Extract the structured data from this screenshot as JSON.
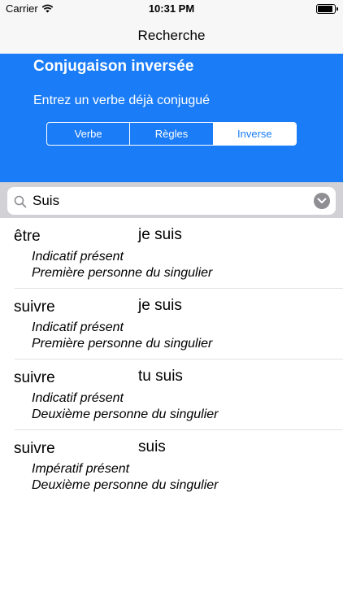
{
  "status_bar": {
    "carrier": "Carrier",
    "time": "10:31 PM",
    "battery_level": 0.9
  },
  "nav": {
    "title": "Recherche"
  },
  "header": {
    "title": "Conjugaison inversée",
    "subtitle": "Entrez un verbe déjà conjugué",
    "segments": [
      {
        "label": "Verbe",
        "selected": false
      },
      {
        "label": "Règles",
        "selected": false
      },
      {
        "label": "Inverse",
        "selected": true
      }
    ]
  },
  "search": {
    "value": "Suis"
  },
  "results": [
    {
      "verb": "être",
      "form": "je suis",
      "mode": "Indicatif présent",
      "person": "Première personne du singulier"
    },
    {
      "verb": "suivre",
      "form": "je suis",
      "mode": "Indicatif présent",
      "person": "Première personne du singulier"
    },
    {
      "verb": "suivre",
      "form": "tu suis",
      "mode": "Indicatif présent",
      "person": "Deuxième personne du singulier"
    },
    {
      "verb": "suivre",
      "form": "suis",
      "mode": "Impératif présent",
      "person": "Deuxième personne du singulier"
    }
  ],
  "colors": {
    "accent": "#1a7cf7",
    "search_bg": "#d1d1d6",
    "bar_bg": "#f7f7f7"
  },
  "icons": {
    "wifi": "wifi-icon",
    "battery": "battery-icon",
    "search": "search-icon",
    "chevron": "chevron-down-icon"
  }
}
